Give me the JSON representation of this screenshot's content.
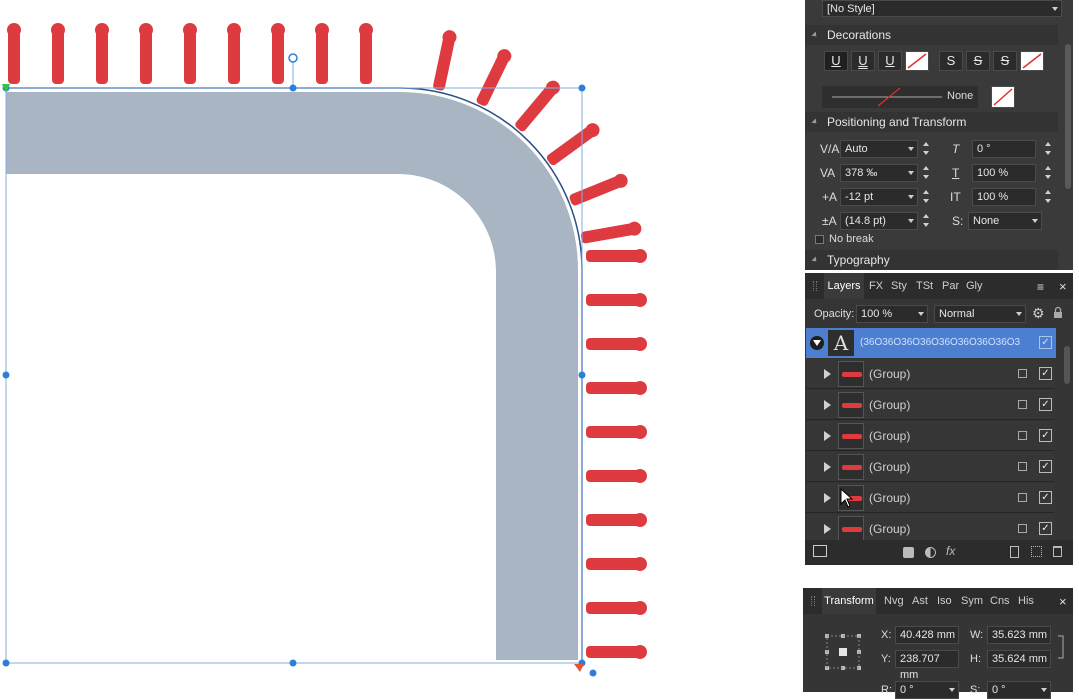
{
  "text_style_select": "[No Style]",
  "decorations": {
    "title": "Decorations",
    "buttons": [
      "U",
      "U",
      "U",
      "S",
      "S",
      "S"
    ],
    "line_style_label": "None"
  },
  "positioning": {
    "title": "Positioning and Transform",
    "kerning": "Auto",
    "tracking": "378 ‰",
    "baseline": "-12 pt",
    "leading": "(14.8 pt)",
    "shear": "0 °",
    "vertical_scale": "100 %",
    "horizontal_scale": "100 %",
    "stretch_label": "None",
    "no_break_label": "No break"
  },
  "typography": {
    "title": "Typography"
  },
  "layers_panel": {
    "tabs": [
      "Layers",
      "FX",
      "Sty",
      "TSt",
      "Par",
      "Gly"
    ],
    "opacity_label": "Opacity:",
    "opacity_value": "100 %",
    "blend_mode": "Normal",
    "text_layer_name": "(36Ô36Ô36Ô36Ô36Ô36Ô36Ô36Ô36Ô...",
    "text_layer_icon": "A",
    "group_rows": [
      "(Group)",
      "(Group)",
      "(Group)",
      "(Group)",
      "(Group)",
      "(Group)"
    ],
    "fx_label": "fx"
  },
  "transform_panel": {
    "tabs": [
      "Transform",
      "Nvg",
      "Ast",
      "Iso",
      "Sym",
      "Cns",
      "His"
    ],
    "x_label": "X:",
    "x_value": "40.428 mm",
    "y_label": "Y:",
    "y_value": "238.707 mm",
    "w_label": "W:",
    "w_value": "35.623 mm",
    "h_label": "H:",
    "h_value": "35.624 mm",
    "r_label": "R:",
    "r_value": "0 °",
    "s_label": "S:",
    "s_value": "0 °"
  },
  "colors": {
    "accent": "#4d7fd1",
    "panel_bg": "#3a3a3a",
    "pin_red": "#dd3b40",
    "band_gray": "#a9b5c3",
    "selection": "#2f7fd8"
  }
}
